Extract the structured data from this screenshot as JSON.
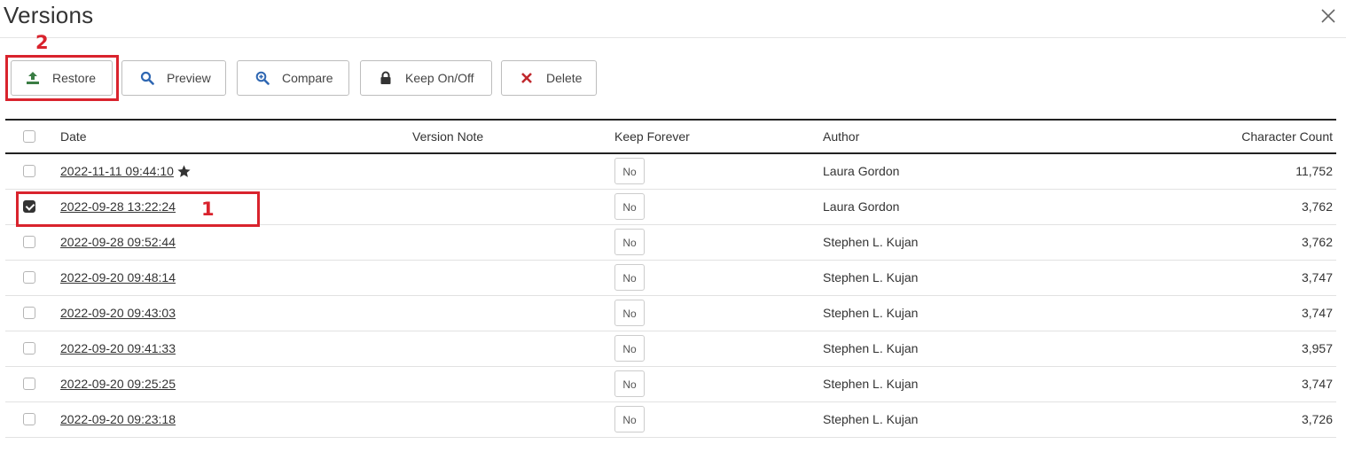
{
  "dialog": {
    "title": "Versions"
  },
  "annotations": {
    "step_one": "1",
    "step_two": "2"
  },
  "toolbar": {
    "restore_label": "Restore",
    "preview_label": "Preview",
    "compare_label": "Compare",
    "keep_label": "Keep On/Off",
    "delete_label": "Delete"
  },
  "table": {
    "headers": {
      "date": "Date",
      "version_note": "Version Note",
      "keep_forever": "Keep Forever",
      "author": "Author",
      "character_count": "Character Count"
    },
    "rows": [
      {
        "date": "2022-11-11 09:44:10",
        "starred": true,
        "checked": false,
        "version_note": "",
        "keep_forever": "No",
        "author": "Laura Gordon",
        "character_count": "11,752"
      },
      {
        "date": "2022-09-28 13:22:24",
        "starred": false,
        "checked": true,
        "version_note": "",
        "keep_forever": "No",
        "author": "Laura Gordon",
        "character_count": "3,762"
      },
      {
        "date": "2022-09-28 09:52:44",
        "starred": false,
        "checked": false,
        "version_note": "",
        "keep_forever": "No",
        "author": "Stephen L. Kujan",
        "character_count": "3,762"
      },
      {
        "date": "2022-09-20 09:48:14",
        "starred": false,
        "checked": false,
        "version_note": "",
        "keep_forever": "No",
        "author": "Stephen L. Kujan",
        "character_count": "3,747"
      },
      {
        "date": "2022-09-20 09:43:03",
        "starred": false,
        "checked": false,
        "version_note": "",
        "keep_forever": "No",
        "author": "Stephen L. Kujan",
        "character_count": "3,747"
      },
      {
        "date": "2022-09-20 09:41:33",
        "starred": false,
        "checked": false,
        "version_note": "",
        "keep_forever": "No",
        "author": "Stephen L. Kujan",
        "character_count": "3,957"
      },
      {
        "date": "2022-09-20 09:25:25",
        "starred": false,
        "checked": false,
        "version_note": "",
        "keep_forever": "No",
        "author": "Stephen L. Kujan",
        "character_count": "3,747"
      },
      {
        "date": "2022-09-20 09:23:18",
        "starred": false,
        "checked": false,
        "version_note": "",
        "keep_forever": "No",
        "author": "Stephen L. Kujan",
        "character_count": "3,726"
      }
    ]
  },
  "colors": {
    "annotation_red": "#d9232d",
    "restore_icon_green": "#3a7d44",
    "preview_icon_blue": "#2f67b2",
    "delete_icon_red": "#c0282d"
  },
  "icons": {
    "restore": "upload-icon",
    "preview": "search-icon",
    "compare": "zoom-in-icon",
    "keep": "lock-icon",
    "delete": "x-icon",
    "close": "close-icon",
    "star": "star-icon"
  }
}
